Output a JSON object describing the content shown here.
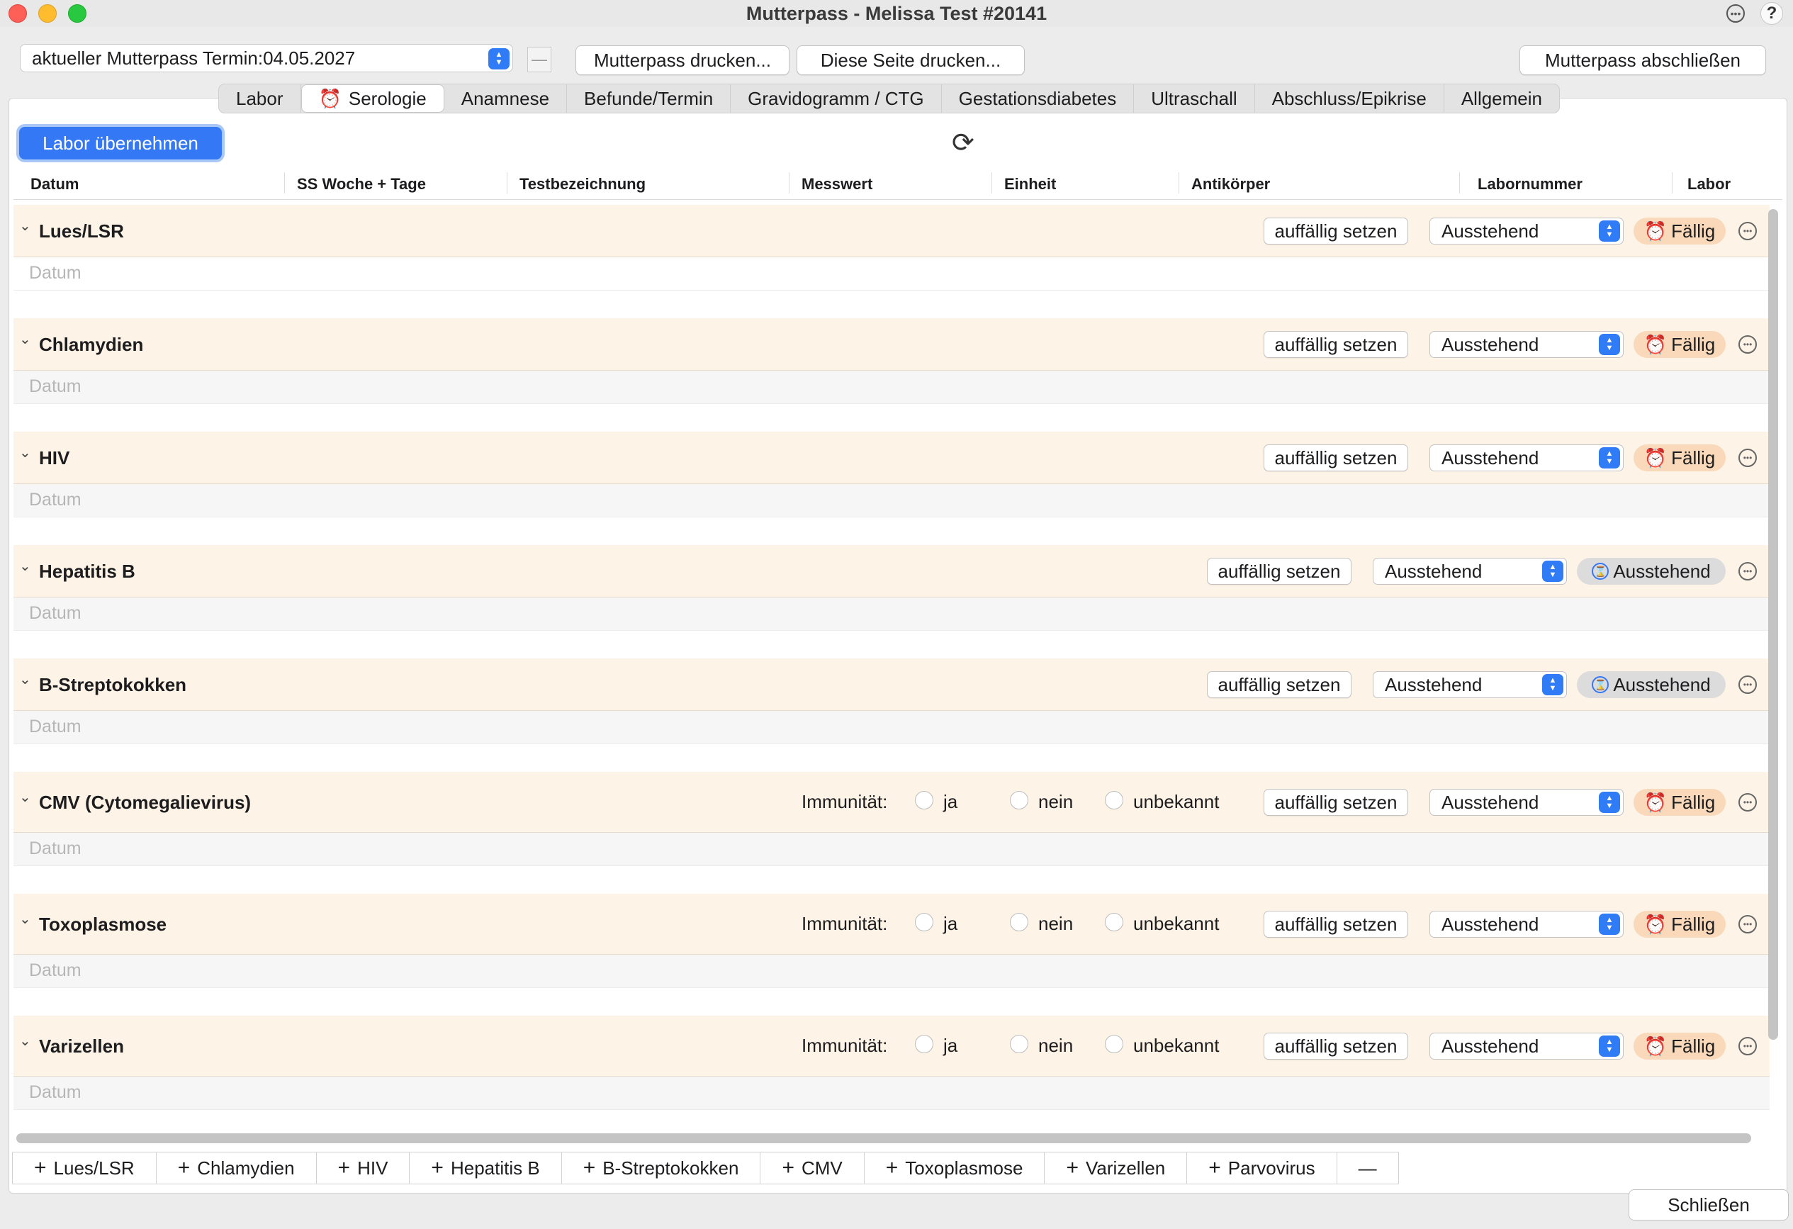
{
  "window": {
    "title": "Mutterpass -  Melissa Test #20141"
  },
  "toolbar": {
    "termin_value": "aktueller Mutterpass Termin:04.05.2027",
    "print_mutterpass": "Mutterpass drucken...",
    "print_page": "Diese Seite drucken...",
    "close_mutterpass": "Mutterpass abschließen"
  },
  "tabs": [
    {
      "label": "Labor"
    },
    {
      "label": "Serologie",
      "active": true
    },
    {
      "label": "Anamnese"
    },
    {
      "label": "Befunde/Termin"
    },
    {
      "label": "Gravidogramm / CTG"
    },
    {
      "label": "Gestationsdiabetes"
    },
    {
      "label": "Ultraschall"
    },
    {
      "label": "Abschluss/Epikrise"
    },
    {
      "label": "Allgemein"
    }
  ],
  "main": {
    "labor_button": "Labor übernehmen",
    "columns": [
      "Datum",
      "SS Woche + Tage",
      "Testbezeichnung",
      "Messwert",
      "Einheit",
      "Antikörper",
      "Labornummer",
      "Labor"
    ],
    "immunity_label": "Immunität:",
    "immunity_options": [
      "ja",
      "nein",
      "unbekannt"
    ],
    "auffaellig_label": "auffällig setzen",
    "select_value": "Ausstehend",
    "datum_placeholder": "Datum",
    "sections": [
      {
        "title": "Lues/LSR",
        "status": "Fällig",
        "status_type": "faellig",
        "immunity": false
      },
      {
        "title": "Chlamydien",
        "status": "Fällig",
        "status_type": "faellig",
        "immunity": false
      },
      {
        "title": "HIV",
        "status": "Fällig",
        "status_type": "faellig",
        "immunity": false
      },
      {
        "title": "Hepatitis B",
        "status": "Ausstehend",
        "status_type": "aus",
        "immunity": false
      },
      {
        "title": "B-Streptokokken",
        "status": "Ausstehend",
        "status_type": "aus",
        "immunity": false
      },
      {
        "title": "CMV (Cytomegalievirus)",
        "status": "Fällig",
        "status_type": "faellig",
        "immunity": true
      },
      {
        "title": "Toxoplasmose",
        "status": "Fällig",
        "status_type": "faellig",
        "immunity": true
      },
      {
        "title": "Varizellen",
        "status": "Fällig",
        "status_type": "faellig",
        "immunity": true
      }
    ]
  },
  "add_bar": [
    "Lues/LSR",
    "Chlamydien",
    "HIV",
    "Hepatitis B",
    "B-Streptokokken",
    "CMV",
    "Toxoplasmose",
    "Varizellen",
    "Parvovirus"
  ],
  "footer": {
    "close_label": "Schließen"
  }
}
